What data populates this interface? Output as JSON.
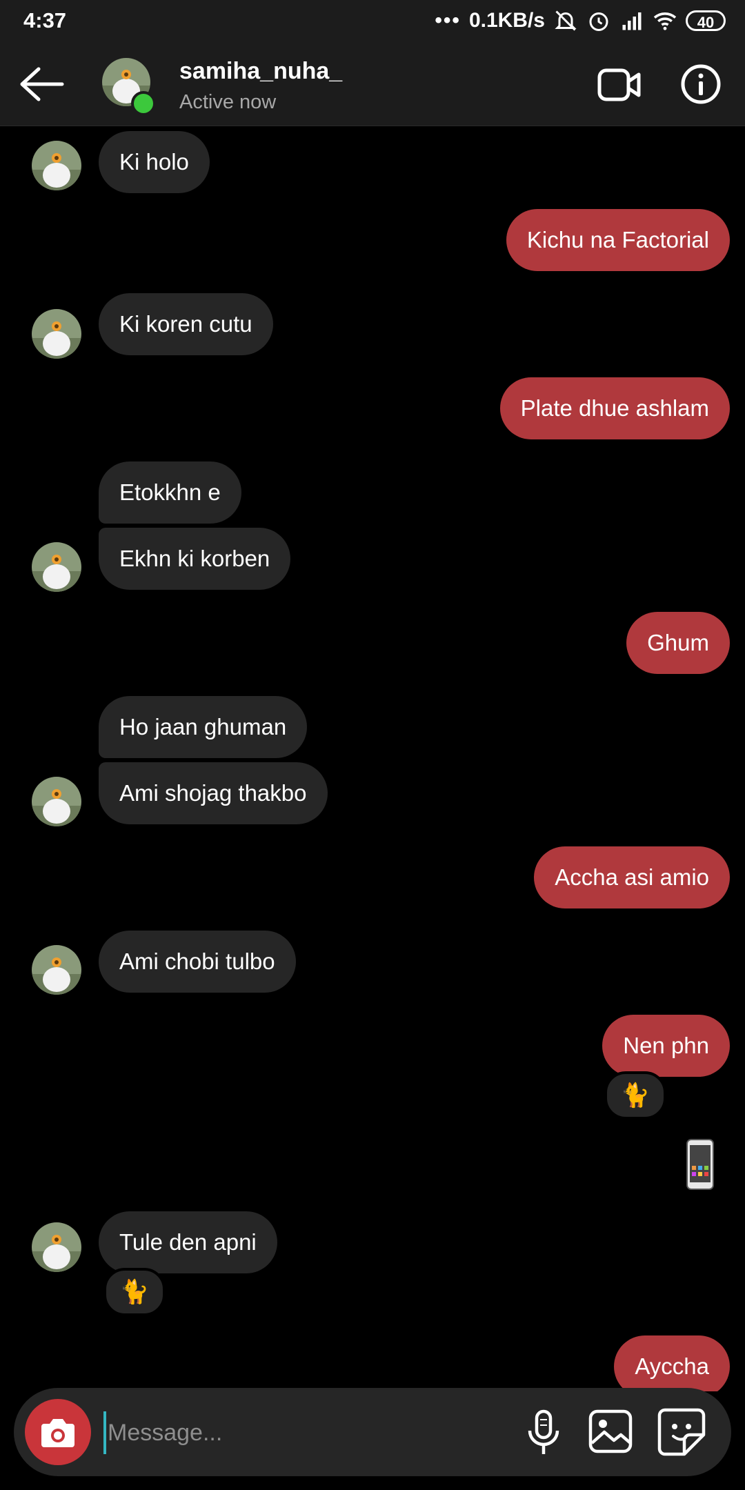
{
  "status_bar": {
    "time": "4:37",
    "network_speed": "0.1KB/s",
    "battery": "40",
    "icons": [
      "dots-icon",
      "mute-bell-icon",
      "alarm-icon",
      "signal-icon",
      "wifi-icon",
      "battery-icon"
    ]
  },
  "header": {
    "username": "samiha_nuha_",
    "status": "Active now",
    "online_color": "#3cc83c",
    "icons": [
      "back-arrow-icon",
      "video-call-icon",
      "info-icon"
    ]
  },
  "colors": {
    "sent_bubble": "#b0393d",
    "received_bubble": "#262626",
    "background": "#000000"
  },
  "messages": [
    {
      "side": "received",
      "text": "Ki holo"
    },
    {
      "side": "sent",
      "text": "Kichu na Factorial"
    },
    {
      "side": "received",
      "text": "Ki koren cutu"
    },
    {
      "side": "sent",
      "text": "Plate dhue ashlam"
    },
    {
      "side": "received",
      "text": "Etokkhn e"
    },
    {
      "side": "received",
      "text": "Ekhn ki korben"
    },
    {
      "side": "sent",
      "text": "Ghum"
    },
    {
      "side": "received",
      "text": "Ho jaan ghuman"
    },
    {
      "side": "received",
      "text": "Ami shojag thakbo"
    },
    {
      "side": "sent",
      "text": "Accha asi amio"
    },
    {
      "side": "received",
      "text": "Ami chobi tulbo"
    },
    {
      "side": "sent",
      "text": "Nen phn",
      "reaction": "🐈"
    },
    {
      "side": "sent",
      "sticker": "phone-sticker"
    },
    {
      "side": "received",
      "text": "Tule den apni",
      "reaction": "🐈"
    },
    {
      "side": "sent",
      "text": "Ayccha"
    }
  ],
  "composer": {
    "placeholder": "Message...",
    "icons": [
      "camera-icon",
      "microphone-icon",
      "gallery-icon",
      "sticker-icon"
    ]
  }
}
